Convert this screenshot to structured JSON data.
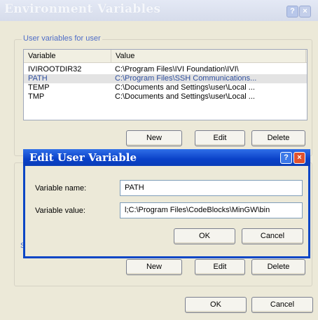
{
  "outer_dialog": {
    "title": "Environment Variables",
    "help_glyph": "?",
    "close_glyph": "×",
    "user_group_label": "User variables for user",
    "system_group_label_fragment": "S",
    "columns": [
      "Variable",
      "Value"
    ],
    "rows": [
      {
        "variable": "IVIROOTDIR32",
        "value": "C:\\Program Files\\IVI Foundation\\IVI\\"
      },
      {
        "variable": "PATH",
        "value": "C:\\Program Files\\SSH Communications..."
      },
      {
        "variable": "TEMP",
        "value": "C:\\Documents and Settings\\user\\Local ..."
      },
      {
        "variable": "TMP",
        "value": "C:\\Documents and Settings\\user\\Local ..."
      }
    ],
    "user_buttons": {
      "new": "New",
      "edit": "Edit",
      "delete": "Delete"
    },
    "system_buttons": {
      "new": "New",
      "edit": "Edit",
      "delete": "Delete"
    },
    "ok": "OK",
    "cancel": "Cancel"
  },
  "edit_dialog": {
    "title": "Edit User Variable",
    "help_glyph": "?",
    "close_glyph": "×",
    "name_label": "Variable name:",
    "name_value": "PATH",
    "value_label": "Variable value:",
    "value_value": "l;C:\\Program Files\\CodeBlocks\\MinGW\\bin",
    "ok": "OK",
    "cancel": "Cancel"
  }
}
